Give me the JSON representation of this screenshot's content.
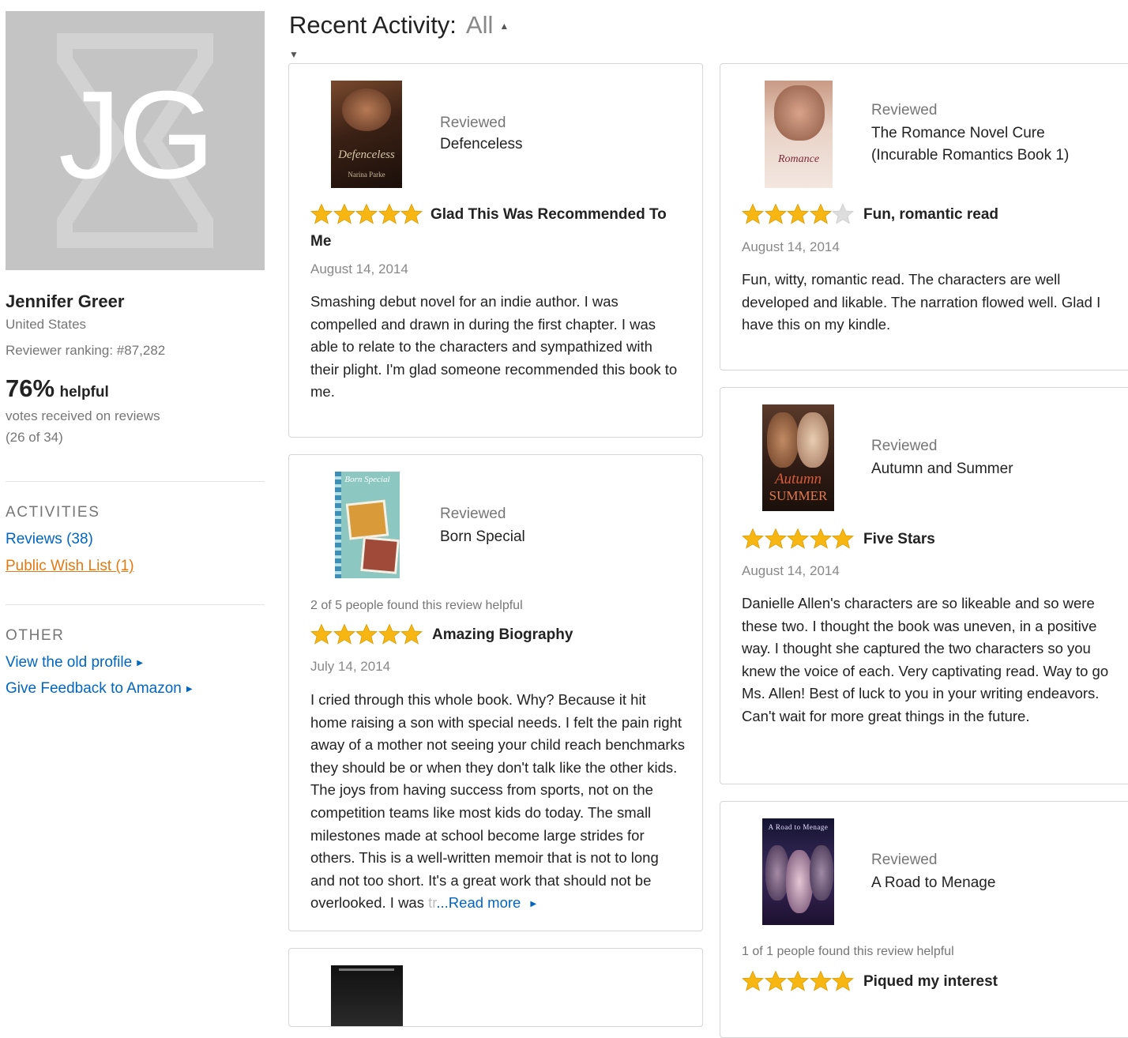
{
  "profile": {
    "initials": "JG",
    "name": "Jennifer Greer",
    "location": "United States",
    "ranking": "Reviewer ranking: #87,282",
    "helpful_pct": "76%",
    "helpful_label": "helpful",
    "votes_line": "votes received on reviews",
    "votes_count": "(26 of 34)"
  },
  "activities": {
    "title": "ACTIVITIES",
    "reviews_link": "Reviews (38)",
    "wishlist_link": "Public Wish List (1)"
  },
  "other": {
    "title": "OTHER",
    "old_profile_link": "View the old profile",
    "feedback_link": "Give Feedback to Amazon"
  },
  "header": {
    "title": "Recent Activity:",
    "filter": "All"
  },
  "colors": {
    "link": "#0066c0",
    "wishlist": "#e47911",
    "star_fill": "#f7b612",
    "star_empty": "#dddddd"
  },
  "reviews": [
    {
      "reviewed_label": "Reviewed",
      "book_title": "Defenceless",
      "cover_text": "Defenceless",
      "cover_author": "Narina Parke",
      "rating": 5,
      "headline": "Glad This Was Recommended To Me",
      "date": "August 14, 2014",
      "body": "Smashing debut novel for an indie author. I was compelled and drawn in during the first chapter. I was able to relate to the characters and sympathized with their plight. I'm glad someone recommended this book to me."
    },
    {
      "reviewed_label": "Reviewed",
      "book_title_line1": "The Romance Novel Cure",
      "book_title_line2": "(Incurable Romantics Book 1)",
      "cover_text": "Romance",
      "rating": 4,
      "headline": "Fun, romantic read",
      "date": "August 14, 2014",
      "body": "Fun, witty, romantic read. The characters are well developed and likable. The narration flowed well. Glad I have this on my kindle."
    },
    {
      "reviewed_label": "Reviewed",
      "book_title": "Born Special",
      "cover_text": "Born Special",
      "helpful_note": "2 of 5 people found this review helpful",
      "rating": 5,
      "headline": "Amazing Biography",
      "date": "July 14, 2014",
      "body": "I cried through this whole book. Why? Because it hit home raising a son with special needs. I felt the pain right away of a mother not seeing your child reach benchmarks they should be or when they don't talk like the other kids. The joys from having success from sports, not on the competition teams like most kids do today. The small milestones made at school become large strides for others. This is a well-written memoir that is not to long and not too short. It's a great work that should not be overlooked. I was",
      "body_fade": "tr",
      "read_more": "...Read more"
    },
    {
      "reviewed_label": "Reviewed",
      "book_title": "Autumn and Summer",
      "cover_text": "Autumn",
      "cover_text2": "SUMMER",
      "rating": 5,
      "headline": "Five Stars",
      "date": "August 14, 2014",
      "body": "Danielle Allen's characters are so likeable and so were these two. I thought the book was uneven, in a positive way. I thought she captured the two characters so you knew the voice of each. Very captivating read. Way to go Ms. Allen! Best of luck to you in your writing endeavors. Can't wait for more great things in the future."
    },
    {
      "reviewed_label": "Reviewed",
      "book_title": "A Road to Menage",
      "cover_text": "A Road to Menage",
      "helpful_note": "1 of 1 people found this review helpful",
      "rating": 5,
      "headline": "Piqued my interest"
    }
  ]
}
